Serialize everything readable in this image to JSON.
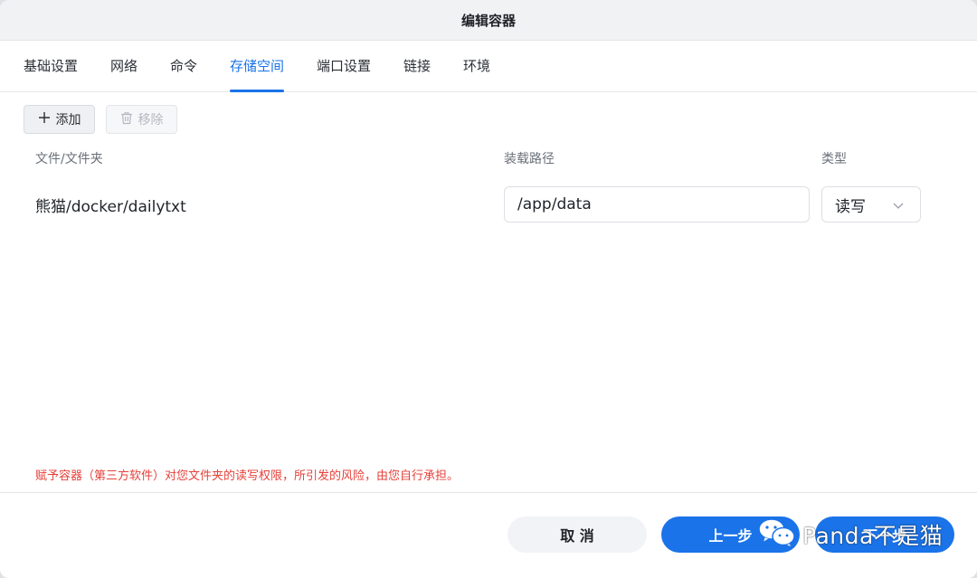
{
  "window": {
    "title": "编辑容器"
  },
  "tabs": [
    {
      "label": "基础设置",
      "active": false
    },
    {
      "label": "网络",
      "active": false
    },
    {
      "label": "命令",
      "active": false
    },
    {
      "label": "存储空间",
      "active": true
    },
    {
      "label": "端口设置",
      "active": false
    },
    {
      "label": "链接",
      "active": false
    },
    {
      "label": "环境",
      "active": false
    }
  ],
  "toolbar": {
    "add": {
      "label": "添加",
      "icon": "plus-icon"
    },
    "remove": {
      "label": "移除",
      "icon": "trash-icon",
      "disabled": true
    }
  },
  "table": {
    "columns": [
      "文件/文件夹",
      "装载路径",
      "类型"
    ],
    "rows": [
      {
        "folder": "熊猫/docker/dailytxt",
        "mount_path": "/app/data",
        "type": "读写"
      }
    ]
  },
  "warning": "赋予容器（第三方软件）对您文件夹的读写权限，所引发的风险，由您自行承担。",
  "footer": {
    "cancel_label": "取 消",
    "prev_label": "上一步",
    "next_label": "下一步"
  },
  "watermark": {
    "text": "Panda不是猫",
    "icon": "wechat-icon"
  },
  "colors": {
    "accent": "#1a73e8",
    "warning": "#e5413a",
    "titlebar_bg": "#f1f2f4"
  }
}
